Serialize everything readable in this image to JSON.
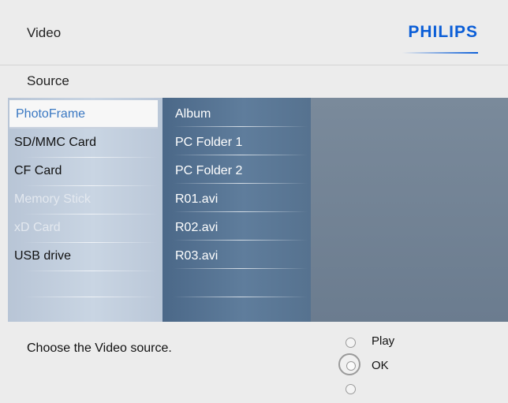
{
  "header": {
    "title": "Video",
    "brand": "PHILIPS"
  },
  "subheader": {
    "title": "Source"
  },
  "sources": [
    {
      "label": "PhotoFrame",
      "state": "selected"
    },
    {
      "label": "SD/MMC Card",
      "state": "normal"
    },
    {
      "label": "CF Card",
      "state": "normal"
    },
    {
      "label": "Memory Stick",
      "state": "disabled"
    },
    {
      "label": "xD Card",
      "state": "disabled"
    },
    {
      "label": "USB drive",
      "state": "normal"
    }
  ],
  "contents": [
    "Album",
    "PC Folder 1",
    "PC Folder 2",
    "R01.avi",
    "R02.avi",
    "R03.avi"
  ],
  "footer": {
    "hint": "Choose the Video source.",
    "play_label": "Play",
    "ok_label": "OK"
  },
  "colors": {
    "brand": "#0b5ed7",
    "selected_text": "#3a78c2"
  }
}
